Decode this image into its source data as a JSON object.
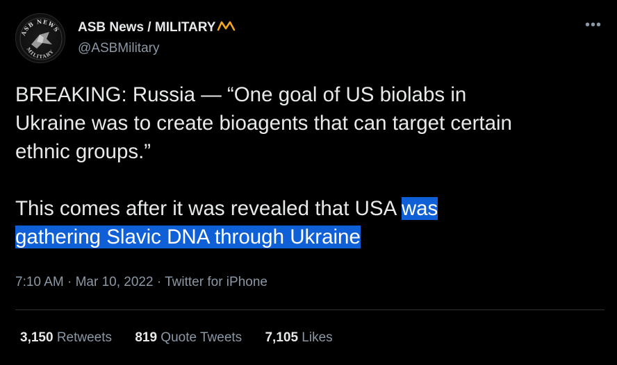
{
  "author": {
    "display_name": "ASB News / MILITARY",
    "handle": "@ASBMilitary",
    "avatar_text_top": "ASB NEWS",
    "avatar_text_bottom": "MILITARY",
    "name_emblem_icon": "crown-emblem-icon",
    "emblem_color": "#f5a623"
  },
  "more_icon": "more-horizontal-icon",
  "tweet": {
    "lines": [
      "BREAKING: Russia — “One goal of US biolabs in",
      "Ukraine was to create bioagents that can target certain",
      "ethnic groups.”"
    ],
    "second_line1_plain": "This comes after it was revealed that USA ",
    "second_line1_highlight": "was ",
    "second_line2_highlight": "gathering Slavic DNA through Ukraine",
    "highlight_color": "#0f60d6"
  },
  "meta": {
    "time": "7:10 AM",
    "sep1": " · ",
    "date": "Mar 10, 2022",
    "sep2": " · ",
    "source": "Twitter for iPhone"
  },
  "stats": {
    "retweets_count": "3,150",
    "retweets_label": "Retweets",
    "quotes_count": "819",
    "quotes_label": "Quote Tweets",
    "likes_count": "7,105",
    "likes_label": "Likes"
  },
  "colors": {
    "background": "#000000",
    "primary_text": "#e7e9ea",
    "secondary_text": "#8b98a5",
    "divider": "#2f3336"
  }
}
